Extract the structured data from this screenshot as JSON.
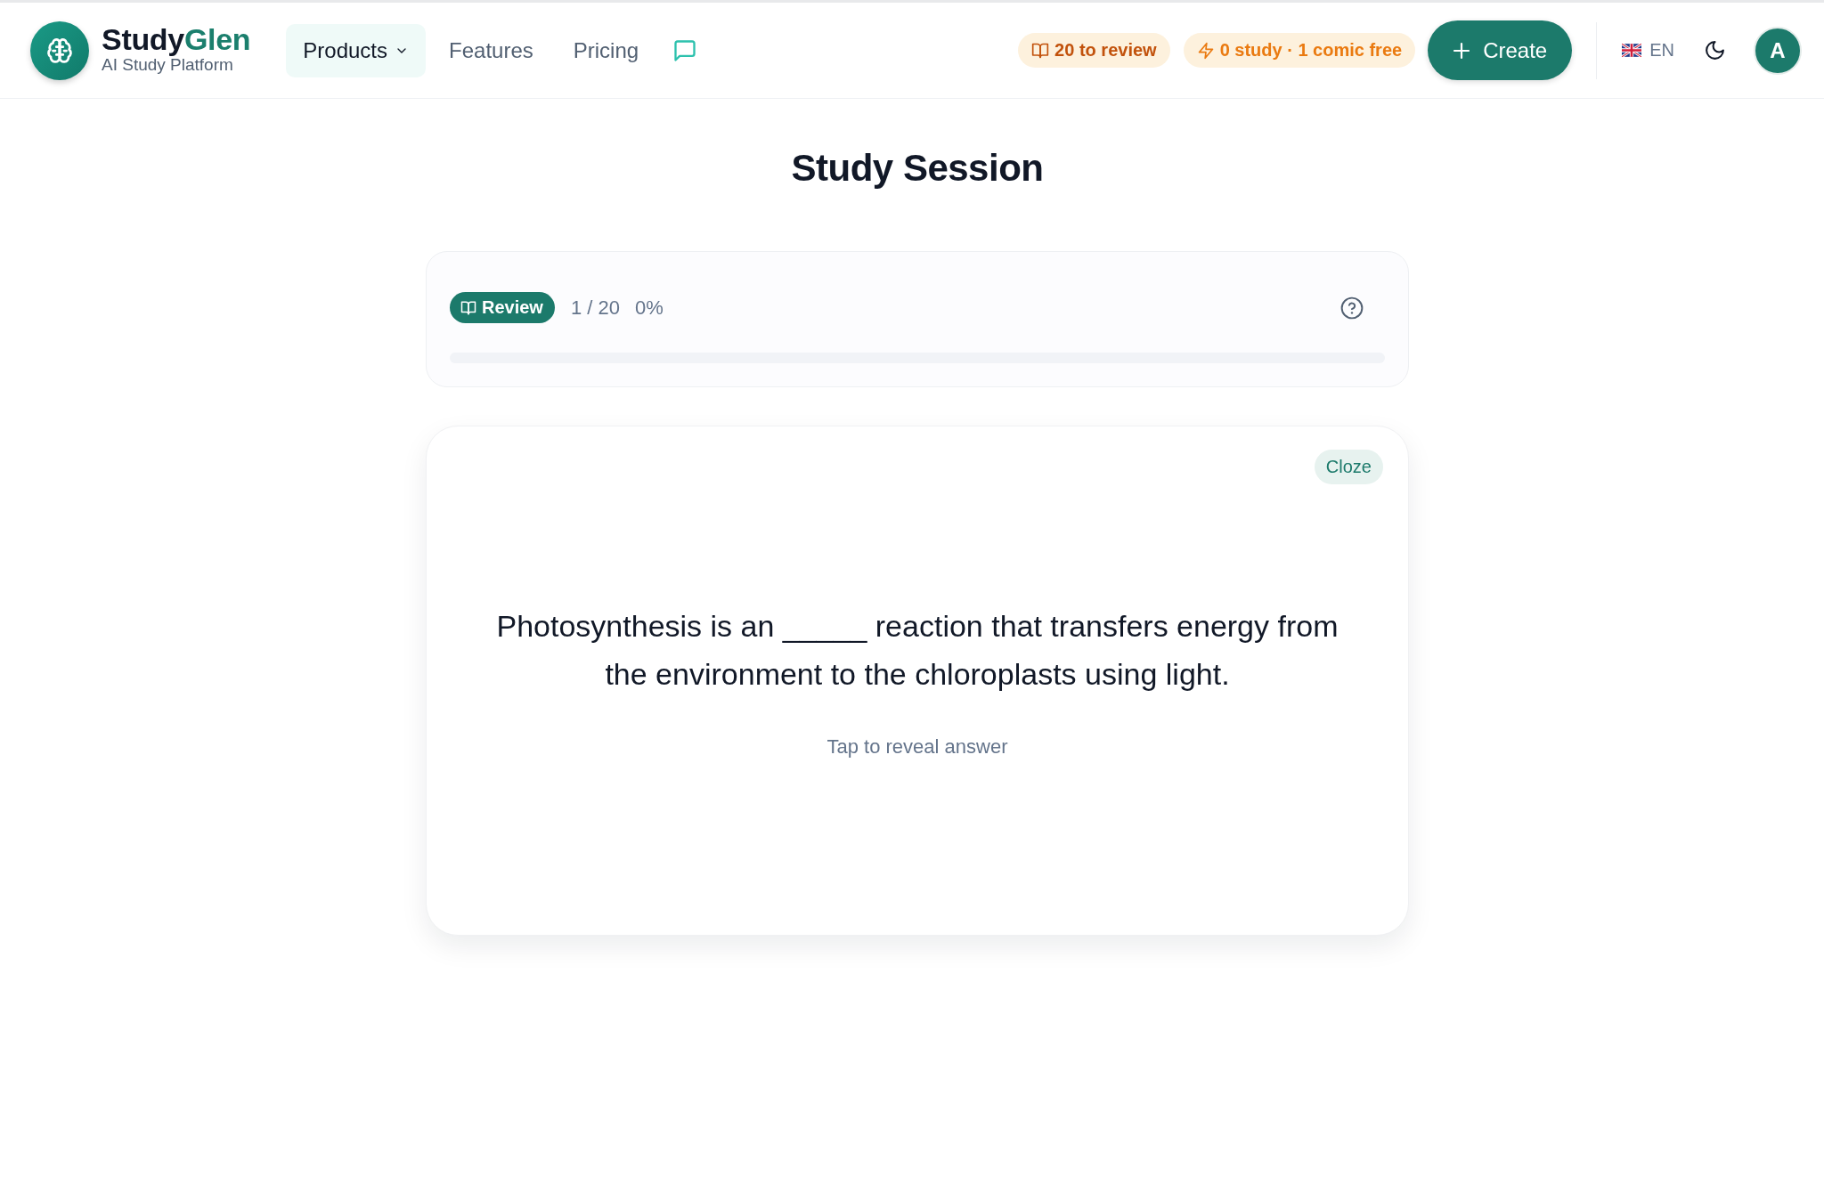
{
  "header": {
    "brand": {
      "name": [
        {
          "text": "Study",
          "accent": false
        },
        {
          "text": "Glen",
          "accent": true
        }
      ],
      "tagline": "AI Study Platform"
    },
    "nav": [
      {
        "kind": "dropdown",
        "label": "Products",
        "selected": true
      },
      {
        "kind": "link",
        "label": "Features",
        "selected": false
      },
      {
        "kind": "link",
        "label": "Pricing",
        "selected": false
      },
      {
        "kind": "chat",
        "selected": false
      }
    ],
    "badges": [
      {
        "kind": "review",
        "label": "20 to review"
      },
      {
        "kind": "quota",
        "label": "0 study · 1 comic free"
      }
    ],
    "create_button": {
      "label": "Create"
    },
    "language": {
      "label": "EN"
    },
    "avatar": {
      "initial": "A"
    }
  },
  "title": "Study Session",
  "progress": {
    "mode": "Review",
    "position": "1 / 20",
    "percent": "0%",
    "level": 0
  },
  "card": {
    "tag": "Cloze",
    "question": "Photosynthesis is an _____ reaction that transfers energy from the environment to the chloroplasts using light.",
    "hint": "Tap to reveal answer"
  }
}
